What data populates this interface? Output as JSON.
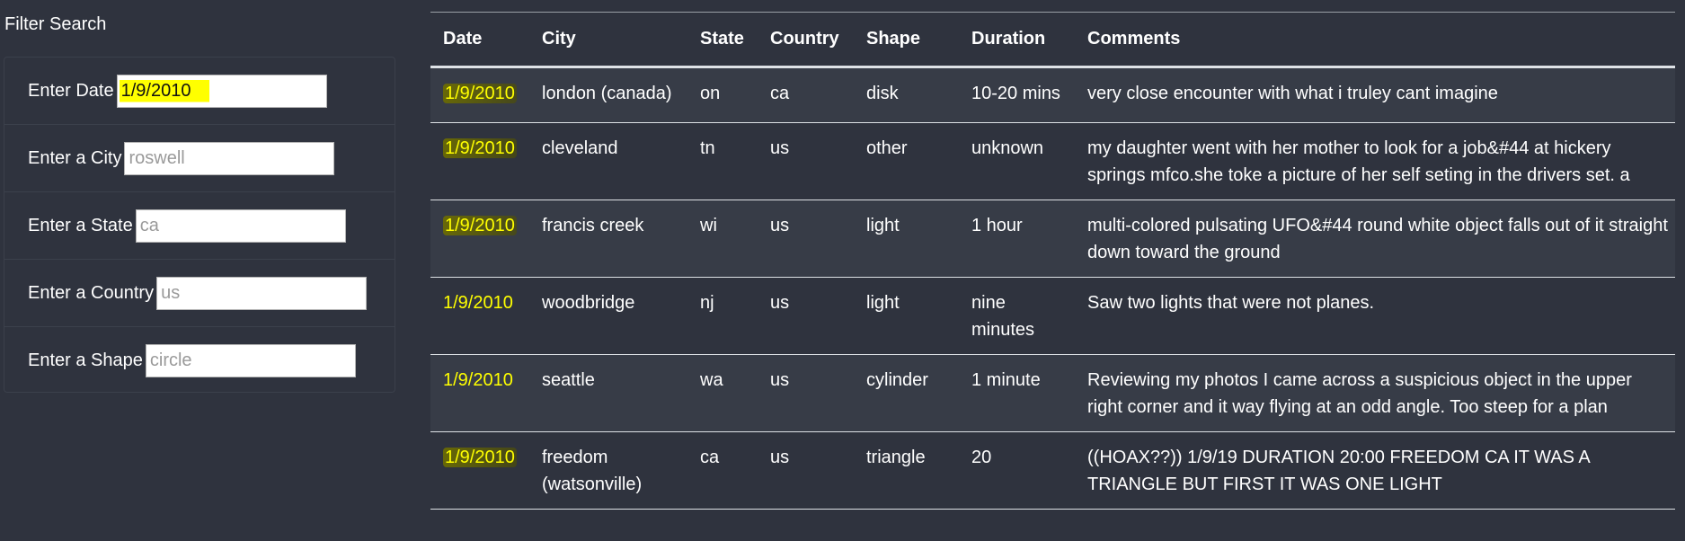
{
  "sidebar": {
    "title": "Filter Search",
    "filters": [
      {
        "label": "Enter Date",
        "value": "1/9/2010",
        "placeholder": ""
      },
      {
        "label": "Enter a City",
        "value": "",
        "placeholder": "roswell"
      },
      {
        "label": "Enter a State",
        "value": "",
        "placeholder": "ca"
      },
      {
        "label": "Enter a Country",
        "value": "",
        "placeholder": "us"
      },
      {
        "label": "Enter a Shape",
        "value": "",
        "placeholder": "circle"
      }
    ]
  },
  "table": {
    "headers": [
      "Date",
      "City",
      "State",
      "Country",
      "Shape",
      "Duration",
      "Comments"
    ],
    "rows": [
      {
        "date": "1/9/2010",
        "city": "london (canada)",
        "state": "on",
        "country": "ca",
        "shape": "disk",
        "duration": "10-20 mins",
        "comments": "very close encounter with what i truley cant imagine"
      },
      {
        "date": "1/9/2010",
        "city": "cleveland",
        "state": "tn",
        "country": "us",
        "shape": "other",
        "duration": "unknown",
        "comments": "my daughter went with her mother to look for a job&#44 at hickery springs mfco.she toke a picture of her self seting in the drivers set. a"
      },
      {
        "date": "1/9/2010",
        "city": "francis creek",
        "state": "wi",
        "country": "us",
        "shape": "light",
        "duration": "1 hour",
        "comments": "multi-colored pulsating UFO&#44 round white object falls out of it straight down toward the ground"
      },
      {
        "date": "1/9/2010",
        "city": "woodbridge",
        "state": "nj",
        "country": "us",
        "shape": "light",
        "duration": "nine minutes",
        "comments": "Saw two lights that were not planes."
      },
      {
        "date": "1/9/2010",
        "city": "seattle",
        "state": "wa",
        "country": "us",
        "shape": "cylinder",
        "duration": "1 minute",
        "comments": "Reviewing my photos I came across a suspicious object in the upper right corner and it way flying at an odd angle. Too steep for a plan"
      },
      {
        "date": "1/9/2010",
        "city": "freedom (watsonville)",
        "state": "ca",
        "country": "us",
        "shape": "triangle",
        "duration": "20",
        "comments": "((HOAX??)) 1/9/19 DURATION 20:00 FREEDOM CA IT WAS A TRIANGLE BUT FIRST IT WAS ONE LIGHT"
      }
    ]
  },
  "colors": {
    "background": "#2f333e",
    "highlight": "#ffff00",
    "text": "#ffffff"
  }
}
